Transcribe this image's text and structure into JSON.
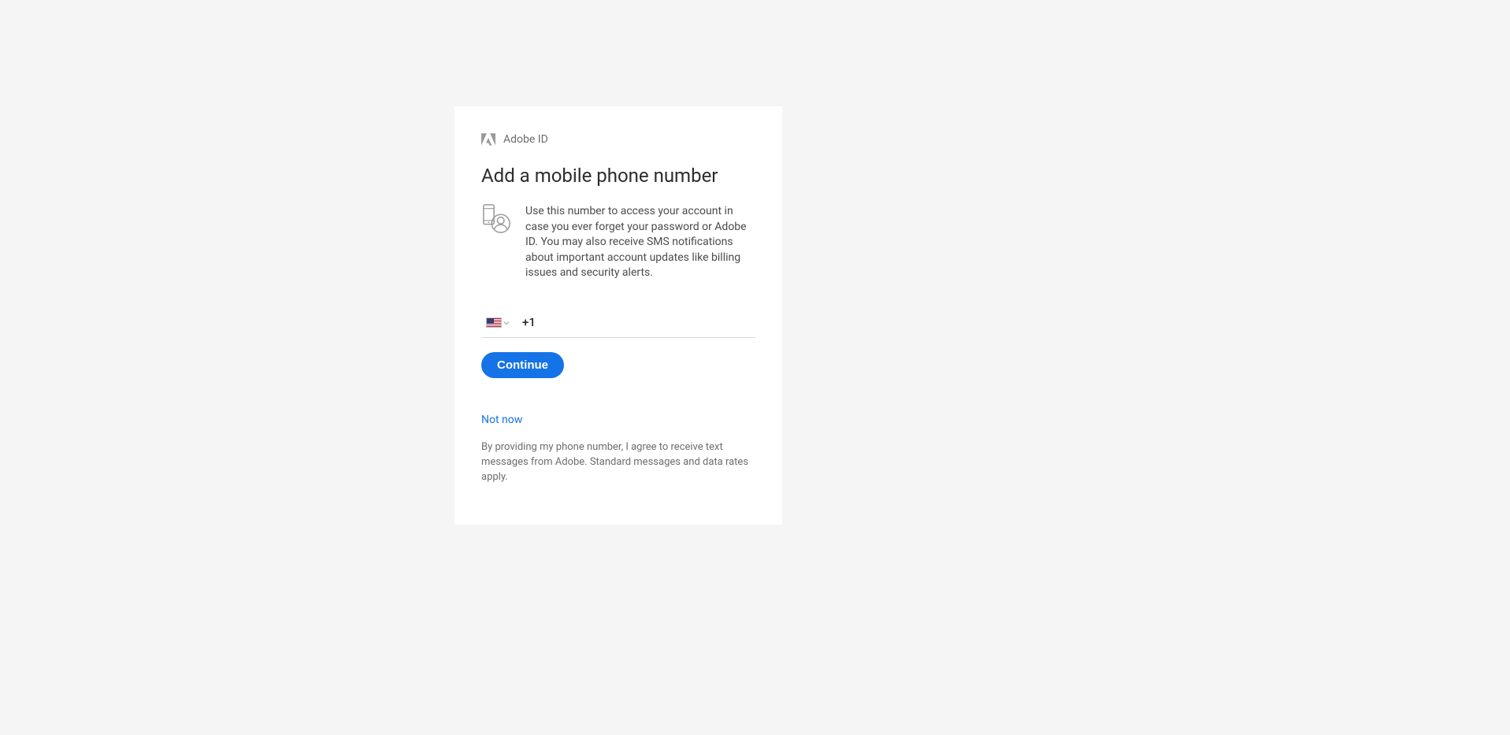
{
  "brand": {
    "label": "Adobe ID"
  },
  "header": {
    "title": "Add a mobile phone number"
  },
  "description": {
    "text": "Use this number to access your account in case you ever forget your password or Adobe ID. You may also receive SMS notifications about important account updates like billing issues and security alerts."
  },
  "phone": {
    "country_code": "+1",
    "value": "",
    "placeholder": ""
  },
  "buttons": {
    "continue": "Continue"
  },
  "links": {
    "not_now": "Not now"
  },
  "legal": {
    "text": "By providing my phone number, I agree to receive text messages from Adobe. Standard messages and data rates apply."
  },
  "colors": {
    "accent": "#1473e6",
    "link": "#1473e6"
  }
}
